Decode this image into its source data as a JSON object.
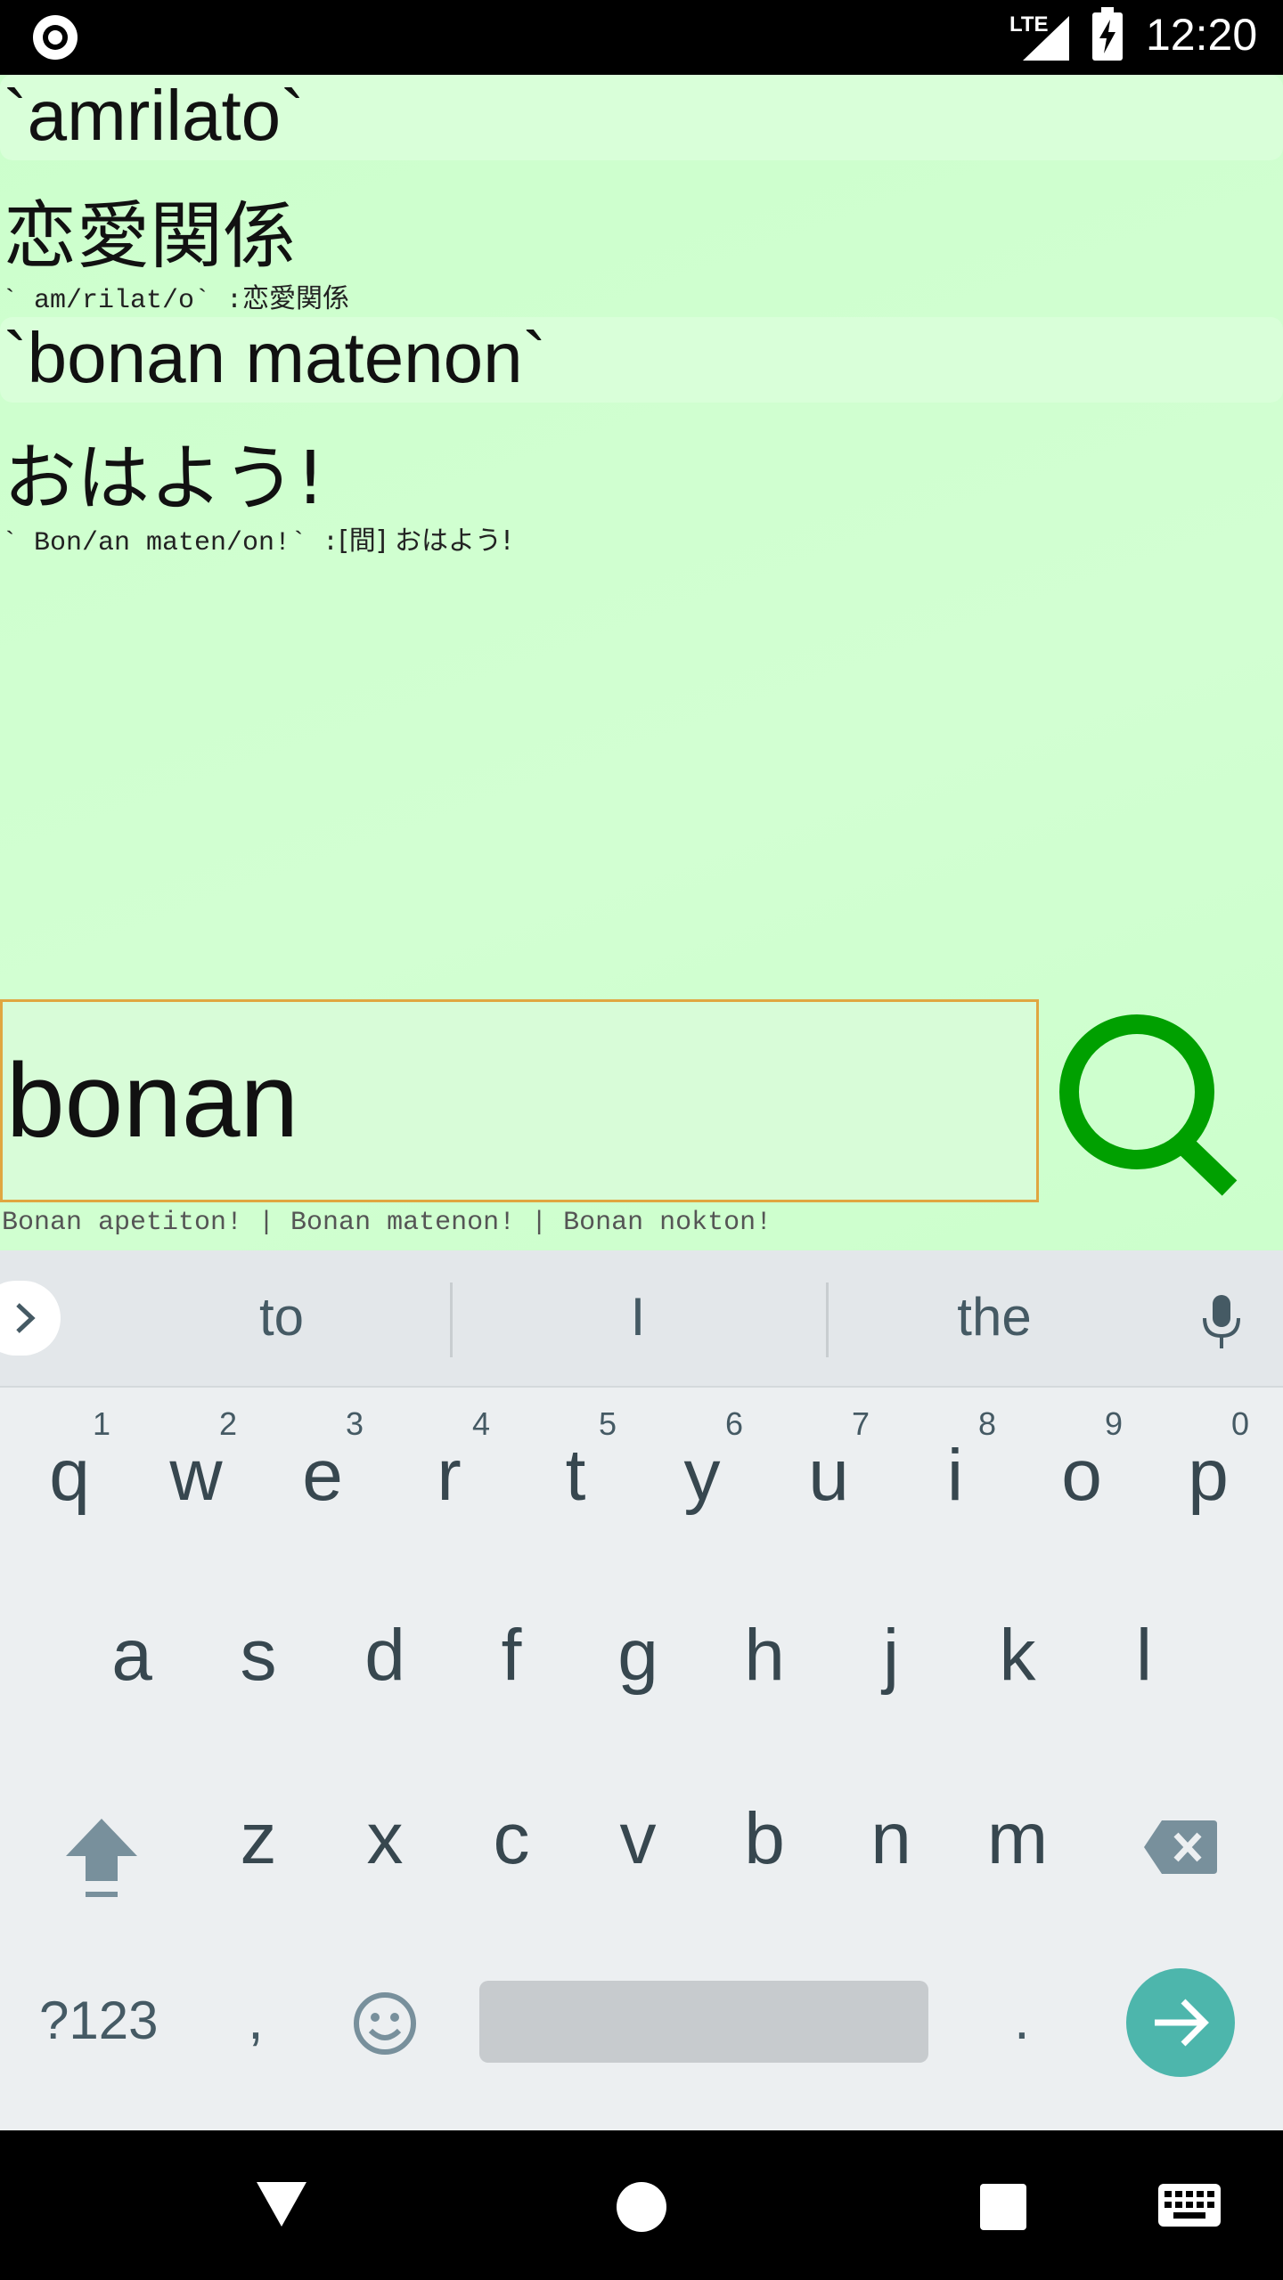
{
  "status_bar": {
    "network": "LTE",
    "time": "12:20"
  },
  "entries": [
    {
      "word": "`amrilato`",
      "translation": "恋愛関係",
      "note_mono": "` am/rilat/o` :",
      "note_text": "恋愛関係"
    },
    {
      "word": "`bonan matenon`",
      "translation": "おはよう!",
      "note_mono": "` Bon/an maten/on!` :",
      "note_text": "[間] おはよう!"
    }
  ],
  "search": {
    "value": "bonan",
    "suggestions": "Bonan apetiton! | Bonan matenon! | Bonan nokton!"
  },
  "keyboard": {
    "suggestions": [
      "to",
      "I",
      "the"
    ],
    "row1": [
      {
        "ch": "q",
        "num": "1"
      },
      {
        "ch": "w",
        "num": "2"
      },
      {
        "ch": "e",
        "num": "3"
      },
      {
        "ch": "r",
        "num": "4"
      },
      {
        "ch": "t",
        "num": "5"
      },
      {
        "ch": "y",
        "num": "6"
      },
      {
        "ch": "u",
        "num": "7"
      },
      {
        "ch": "i",
        "num": "8"
      },
      {
        "ch": "o",
        "num": "9"
      },
      {
        "ch": "p",
        "num": "0"
      }
    ],
    "row2": [
      "a",
      "s",
      "d",
      "f",
      "g",
      "h",
      "j",
      "k",
      "l"
    ],
    "row3": [
      "z",
      "x",
      "c",
      "v",
      "b",
      "n",
      "m"
    ],
    "symbols_label": "?123",
    "comma_label": ",",
    "period_label": "."
  },
  "colors": {
    "background": "#ccffcc",
    "search_icon": "#00a000",
    "search_border": "#e0a640",
    "enter_key": "#4db6ac"
  }
}
